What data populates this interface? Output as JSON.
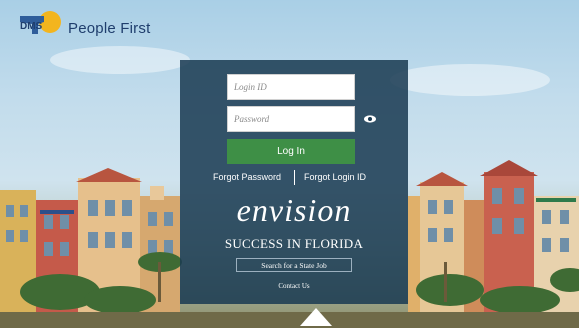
{
  "header": {
    "logo_text": "DMS",
    "app_title": "People First"
  },
  "login": {
    "login_id_placeholder": "Login ID",
    "password_placeholder": "Password",
    "login_button": "Log In",
    "forgot_password": "Forgot Password",
    "forgot_login_id": "Forgot Login ID"
  },
  "promo": {
    "envision": "envision",
    "tagline": "SUCCESS IN FLORIDA",
    "search_job": "Search for a State Job",
    "contact_us": "Contact Us"
  },
  "icons": {
    "eye": "eye-icon",
    "logo": "florida-sun-logo-icon"
  },
  "colors": {
    "panel": "#1a3a52",
    "login_button": "#3e8f46",
    "title": "#1f3e6d"
  }
}
